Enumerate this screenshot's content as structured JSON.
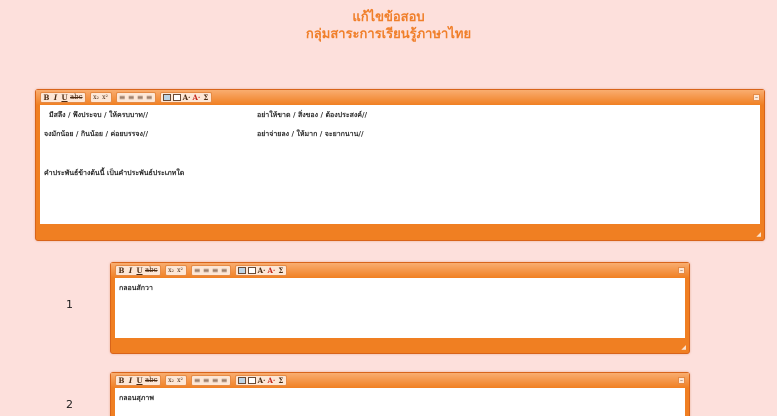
{
  "page": {
    "title_line1": "แก้ไขข้อสอบ",
    "title_line2": "กลุ่มสาระการเรียนรู้ภาษาไทย"
  },
  "toolbar": {
    "buttons": [
      "B",
      "I",
      "U",
      "abc",
      "x₂",
      "x²",
      "≡",
      "≡",
      "≡",
      "≡",
      "img",
      "table",
      "A·",
      "A·",
      "Σ"
    ]
  },
  "main_editor": {
    "row1_col1": "มีสลึง / พึงประจบ / ให้ครบบาท//",
    "row1_col2": "อย่าให้ขาด / สิ่งของ / ต้องประสงค์//",
    "row2_col1": "จงมักน้อย / กินน้อย / ค่อยบรรจง//",
    "row2_col2": "อย่าจ่ายลง / ให้มาก / จะยากนาน//",
    "question": "คำประพันธ์ข้างต้นนี้ เป็นคำประพันธ์ประเภทใด"
  },
  "choices": [
    {
      "number": "1",
      "text": "กลอนสักวา"
    },
    {
      "number": "2",
      "text": "กลอนสุภาพ"
    }
  ],
  "colors": {
    "background": "#fde0dc",
    "accent": "#f07f22",
    "title": "#f07f2a"
  }
}
